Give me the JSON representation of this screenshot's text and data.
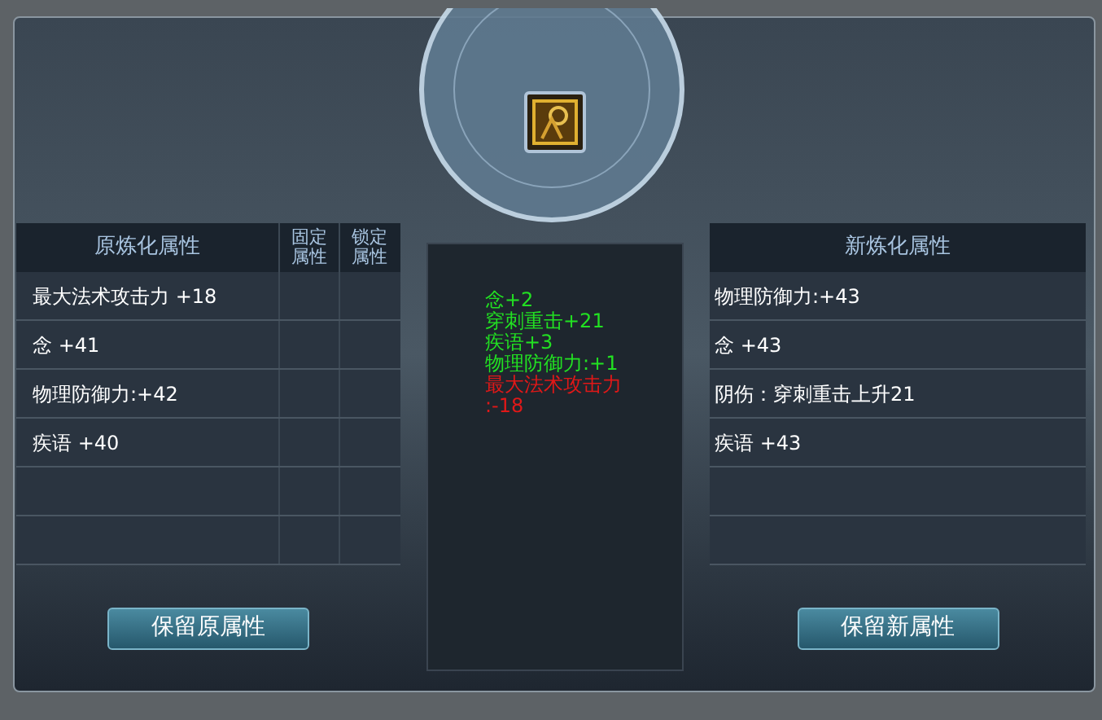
{
  "original": {
    "header": "原炼化属性",
    "column_headers": [
      "固定属性",
      "锁定属性"
    ],
    "rows": [
      {
        "text": "最大法术攻击力 +18"
      },
      {
        "text": "念 +41"
      },
      {
        "text": "物理防御力:+42"
      },
      {
        "text": "疾语 +40"
      }
    ]
  },
  "changes": [
    {
      "text": "念+2",
      "kind": "gain"
    },
    {
      "text": "穿刺重击+21",
      "kind": "gain"
    },
    {
      "text": "疾语+3",
      "kind": "gain"
    },
    {
      "text": "物理防御力:+1",
      "kind": "gain"
    },
    {
      "text": "最大法术攻击力:-18",
      "kind": "loss"
    }
  ],
  "new": {
    "header": "新炼化属性",
    "rows": [
      {
        "text": "物理防御力:+43"
      },
      {
        "text": "念 +43"
      },
      {
        "text": "阴伤：穿刺重击上升21"
      },
      {
        "text": "疾语 +43"
      }
    ]
  },
  "buttons": [
    "保留原属性",
    "保留新属性"
  ]
}
